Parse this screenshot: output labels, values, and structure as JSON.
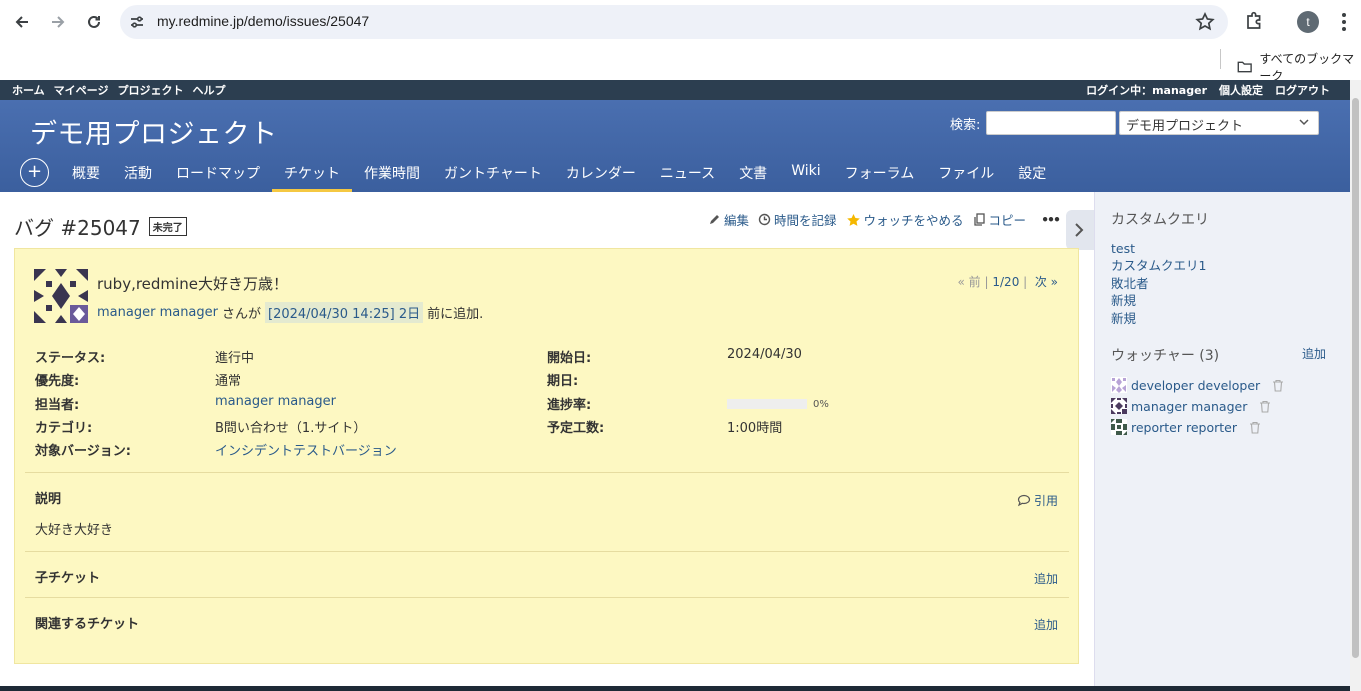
{
  "browser": {
    "url": "my.redmine.jp/demo/issues/25047",
    "profile_initial": "t",
    "bookmarks_label": "すべてのブックマーク"
  },
  "topmenu": {
    "items": [
      "ホーム",
      "マイページ",
      "プロジェクト",
      "ヘルプ"
    ],
    "logged_in_as": "ログイン中：manager",
    "account": "個人設定",
    "logout": "ログアウト"
  },
  "header": {
    "project_title": "デモ用プロジェクト",
    "search_label": "検索:",
    "search_value": "",
    "project_select": "デモ用プロジェクト"
  },
  "mainmenu": {
    "plus": "+",
    "items": [
      "概要",
      "活動",
      "ロードマップ",
      "チケット",
      "作業時間",
      "ガントチャート",
      "カレンダー",
      "ニュース",
      "文書",
      "Wiki",
      "フォーラム",
      "ファイル",
      "設定"
    ],
    "selected": "チケット"
  },
  "issue": {
    "heading": "バグ #25047",
    "status_badge": "未完了",
    "actions": {
      "edit": "編集",
      "log_time": "時間を記録",
      "unwatch": "ウォッチをやめる",
      "copy": "コピー",
      "more": "•••"
    },
    "subject": "ruby,redmine大好き万歳！",
    "author": "manager manager",
    "author_suffix": "さんが",
    "added_time": "[2024/04/30 14:25] 2日",
    "added_suffix": "前に追加.",
    "prev": "« 前",
    "position": "1/20",
    "next": "次 »",
    "attributes": {
      "status_label": "ステータス:",
      "status": "進行中",
      "priority_label": "優先度:",
      "priority": "通常",
      "assignee_label": "担当者:",
      "assignee": "manager manager",
      "category_label": "カテゴリ:",
      "category": "B問い合わせ（1.サイト）",
      "version_label": "対象バージョン:",
      "version": "インシデントテストバージョン",
      "start_date_label": "開始日:",
      "start_date": "2024/04/30",
      "due_date_label": "期日:",
      "due_date": "",
      "done_ratio_label": "進捗率:",
      "done_ratio": 0,
      "done_ratio_text": "0%",
      "estimated_label": "予定工数:",
      "estimated": "1:00時間"
    },
    "description_title": "説明",
    "quote": "引用",
    "description": "大好き大好き",
    "subtasks_title": "子チケット",
    "subtasks_add": "追加",
    "relations_title": "関連するチケット",
    "relations_add": "追加"
  },
  "sidebar": {
    "custom_queries_title": "カスタムクエリ",
    "custom_queries": [
      "test",
      "カスタムクエリ1",
      "敗北者",
      "新規",
      "新規"
    ],
    "watchers_title": "ウォッチャー (3)",
    "watchers_add": "追加",
    "watchers": [
      "developer developer",
      "manager manager",
      "reporter reporter"
    ]
  },
  "colors": {
    "header": "#4a6fb0",
    "topmenu": "#2c3e50",
    "issue_bg": "#fdf8c2",
    "link": "#2a5a8a",
    "sidebar": "#eef1f7"
  }
}
